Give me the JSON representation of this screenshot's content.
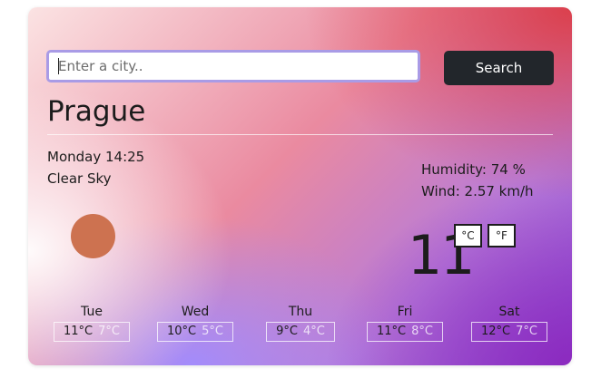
{
  "search": {
    "placeholder": "Enter a city..",
    "value": "",
    "button_label": "Search"
  },
  "current": {
    "city": "Prague",
    "datetime": "Monday 14:25",
    "condition": "Clear Sky",
    "humidity": "Humidity: 74 %",
    "wind": "Wind: 2.57 km/h",
    "temperature": "11",
    "unit_c_label": "°C",
    "unit_f_label": "°F",
    "icon": "sun-icon",
    "icon_color": "#cd7250"
  },
  "forecast": [
    {
      "day": "Tue",
      "high": "11°C",
      "low": "7°C"
    },
    {
      "day": "Wed",
      "high": "10°C",
      "low": "5°C"
    },
    {
      "day": "Thu",
      "high": "9°C",
      "low": "4°C"
    },
    {
      "day": "Fri",
      "high": "11°C",
      "low": "8°C"
    },
    {
      "day": "Sat",
      "high": "12°C",
      "low": "7°C"
    }
  ],
  "colors": {
    "button": "#22262b",
    "input_border": "#a99be6",
    "gradient": [
      "#fbe3e3",
      "#ea8aa0",
      "#dc3c46",
      "#b77bd9",
      "#8b4fd6"
    ]
  }
}
